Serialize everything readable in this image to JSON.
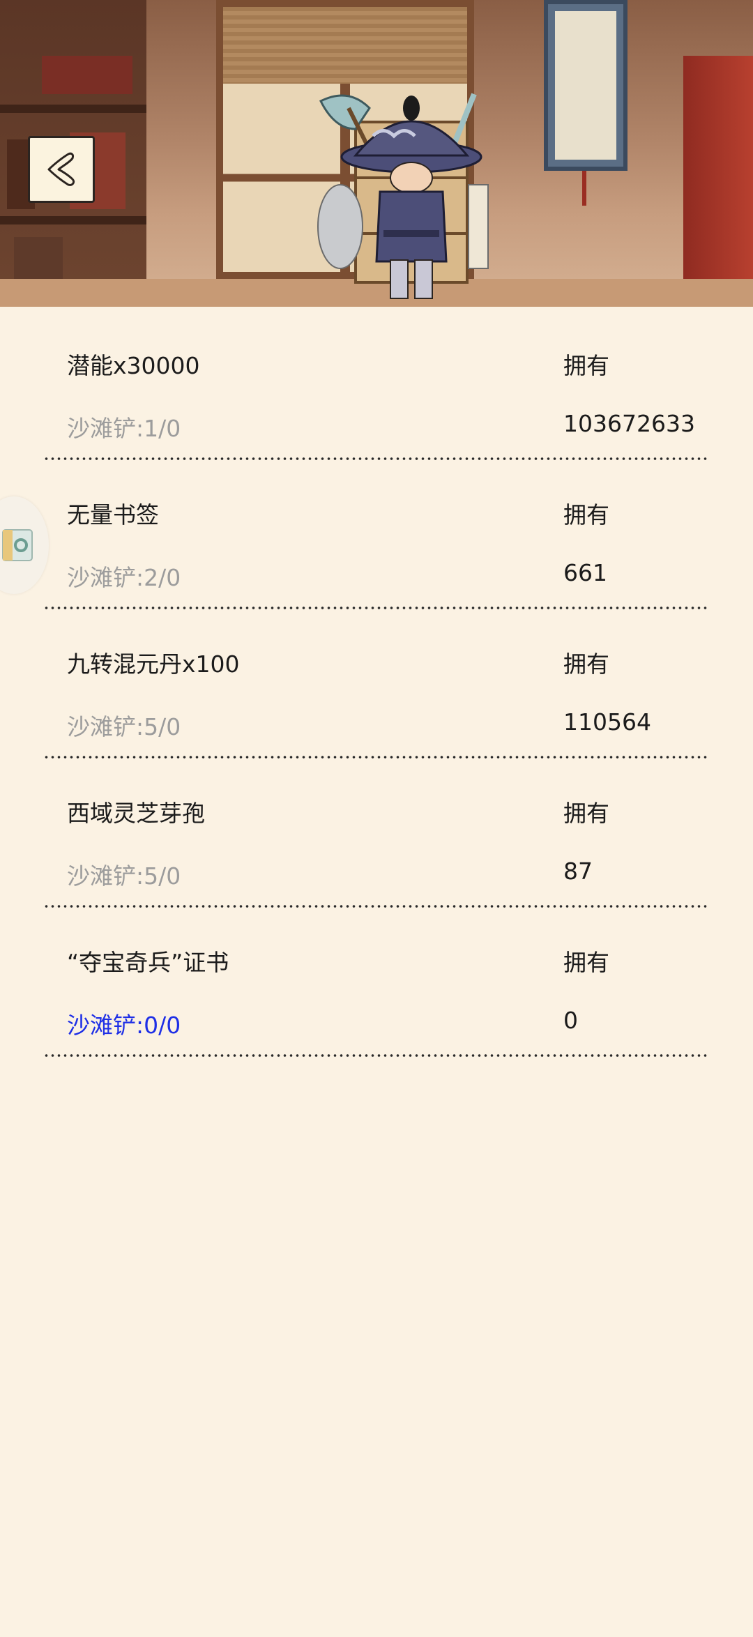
{
  "header": {
    "back_icon": "chevron-left-icon"
  },
  "side_badge": {
    "icon": "side-float-icon"
  },
  "items": [
    {
      "name": "潜能x30000",
      "shovel": "沙滩铲:1/0",
      "own_label": "拥有",
      "own_value": "103672633",
      "shovel_color": "#9C9C9C"
    },
    {
      "name": "无量书签",
      "shovel": "沙滩铲:2/0",
      "own_label": "拥有",
      "own_value": "661",
      "shovel_color": "#9C9C9C"
    },
    {
      "name": "九转混元丹x100",
      "shovel": "沙滩铲:5/0",
      "own_label": "拥有",
      "own_value": "110564",
      "shovel_color": "#9C9C9C"
    },
    {
      "name": "西域灵芝芽孢",
      "shovel": "沙滩铲:5/0",
      "own_label": "拥有",
      "own_value": "87",
      "shovel_color": "#9C9C9C"
    },
    {
      "name": "“夺宝奇兵”证书",
      "shovel": "沙滩铲:0/0",
      "own_label": "拥有",
      "own_value": "0",
      "shovel_color": "#1E2FE6"
    }
  ],
  "colors": {
    "background": "#FBF2E3",
    "text": "#1B1B1B",
    "muted": "#9C9C9C",
    "highlight": "#1E2FE6"
  }
}
